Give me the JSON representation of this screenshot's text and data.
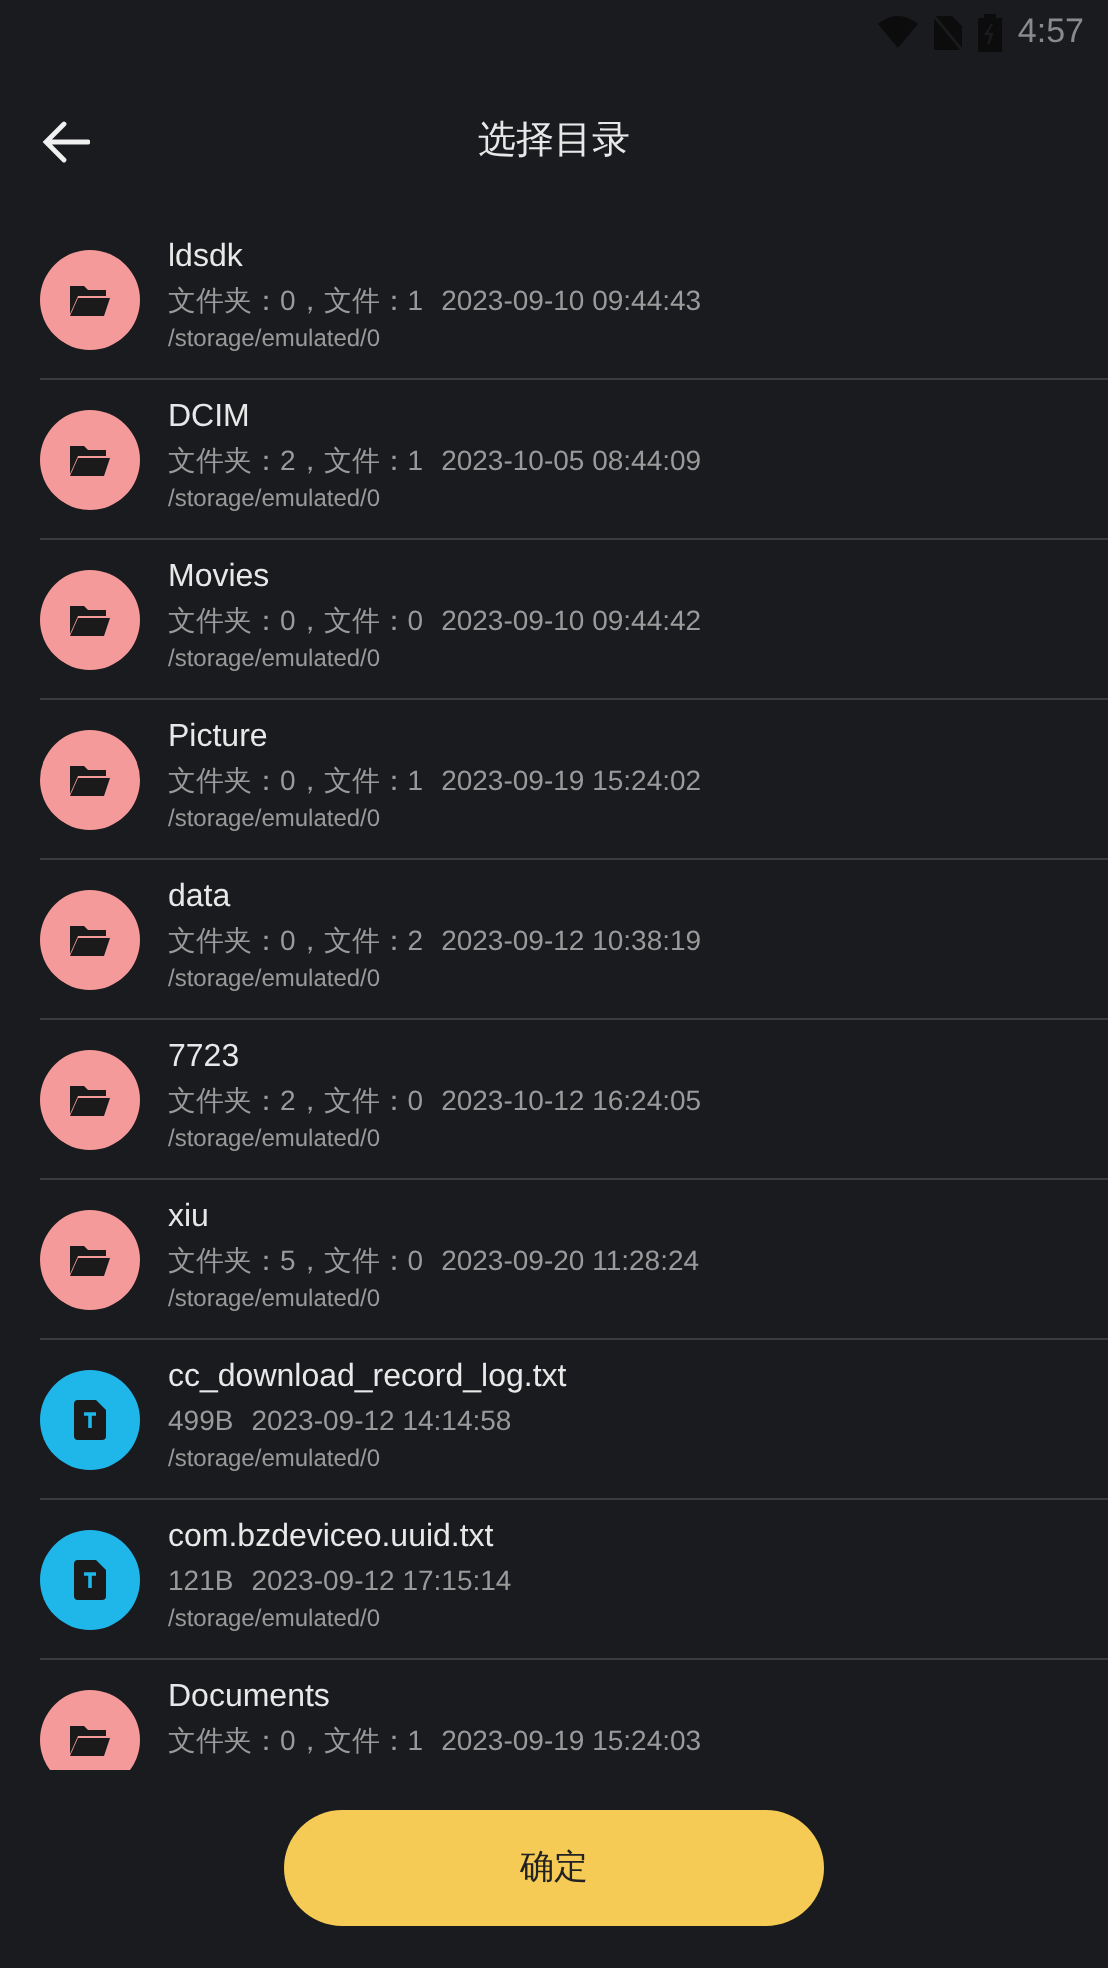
{
  "status_bar": {
    "time": "4:57"
  },
  "header": {
    "title": "选择目录"
  },
  "items": [
    {
      "kind": "folder",
      "name": "ldsdk",
      "info": "文件夹：0，文件：1",
      "date": "2023-09-10 09:44:43",
      "path": "/storage/emulated/0"
    },
    {
      "kind": "folder",
      "name": "DCIM",
      "info": "文件夹：2，文件：1",
      "date": "2023-10-05 08:44:09",
      "path": "/storage/emulated/0"
    },
    {
      "kind": "folder",
      "name": "Movies",
      "info": "文件夹：0，文件：0",
      "date": "2023-09-10 09:44:42",
      "path": "/storage/emulated/0"
    },
    {
      "kind": "folder",
      "name": "Picture",
      "info": "文件夹：0，文件：1",
      "date": "2023-09-19 15:24:02",
      "path": "/storage/emulated/0"
    },
    {
      "kind": "folder",
      "name": "data",
      "info": "文件夹：0，文件：2",
      "date": "2023-09-12 10:38:19",
      "path": "/storage/emulated/0"
    },
    {
      "kind": "folder",
      "name": "7723",
      "info": "文件夹：2，文件：0",
      "date": "2023-10-12 16:24:05",
      "path": "/storage/emulated/0"
    },
    {
      "kind": "folder",
      "name": "xiu",
      "info": "文件夹：5，文件：0",
      "date": "2023-09-20 11:28:24",
      "path": "/storage/emulated/0"
    },
    {
      "kind": "file",
      "name": "cc_download_record_log.txt",
      "info": "499B",
      "date": "2023-09-12 14:14:58",
      "path": "/storage/emulated/0"
    },
    {
      "kind": "file",
      "name": "com.bzdeviceo.uuid.txt",
      "info": "121B",
      "date": "2023-09-12 17:15:14",
      "path": "/storage/emulated/0"
    },
    {
      "kind": "folder",
      "name": "Documents",
      "info": "文件夹：0，文件：1",
      "date": "2023-09-19 15:24:03"
    }
  ],
  "confirm_button": {
    "label": "确定"
  }
}
